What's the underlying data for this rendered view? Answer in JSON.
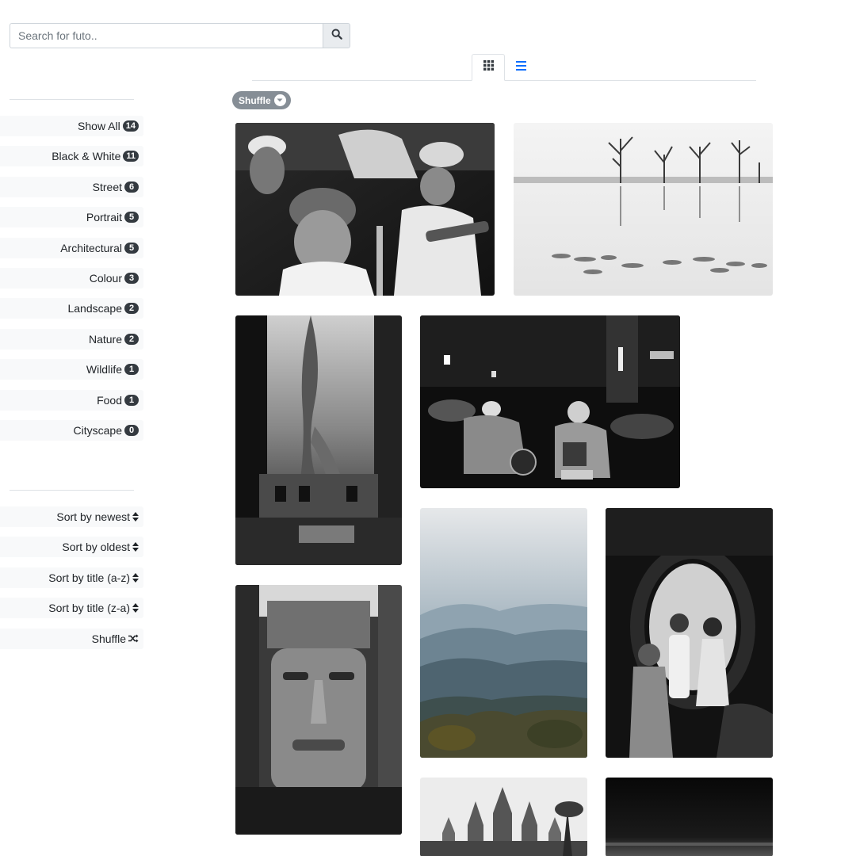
{
  "search": {
    "placeholder": "Search for futo..",
    "value": "",
    "icon": "search-icon"
  },
  "view_tabs": [
    {
      "name": "grid",
      "icon": "grid-icon",
      "active": true
    },
    {
      "name": "list",
      "icon": "list-icon",
      "active": false,
      "color": "#0d6efd"
    }
  ],
  "shuffle_pill": {
    "label": "Shuffle",
    "icon": "chevron-down-icon"
  },
  "filters": [
    {
      "label": "Show All",
      "count": "14"
    },
    {
      "label": "Black & White",
      "count": "11"
    },
    {
      "label": "Street",
      "count": "6"
    },
    {
      "label": "Portrait",
      "count": "5"
    },
    {
      "label": "Architectural",
      "count": "5"
    },
    {
      "label": "Colour",
      "count": "3"
    },
    {
      "label": "Landscape",
      "count": "2"
    },
    {
      "label": "Nature",
      "count": "2"
    },
    {
      "label": "Wildlife",
      "count": "1"
    },
    {
      "label": "Food",
      "count": "1"
    },
    {
      "label": "Cityscape",
      "count": "0"
    }
  ],
  "sorts": [
    {
      "label": "Sort by newest",
      "icon": "sort-icon"
    },
    {
      "label": "Sort by oldest",
      "icon": "sort-icon"
    },
    {
      "label": "Sort by title (a-z)",
      "icon": "sort-icon"
    },
    {
      "label": "Sort by title (z-a)",
      "icon": "sort-icon"
    },
    {
      "label": "Shuffle",
      "icon": "shuffle-icon"
    }
  ],
  "photos": [
    {
      "subject": "street-musicians",
      "tone": "bw"
    },
    {
      "subject": "lake-trees",
      "tone": "bw"
    },
    {
      "subject": "temple-tree",
      "tone": "bw"
    },
    {
      "subject": "motorbike-street",
      "tone": "bw"
    },
    {
      "subject": "stone-face",
      "tone": "bw"
    },
    {
      "subject": "mountain-mist",
      "tone": "colour"
    },
    {
      "subject": "couple-portrait",
      "tone": "bw"
    },
    {
      "subject": "angkor-wat",
      "tone": "bw"
    },
    {
      "subject": "dark-water",
      "tone": "bw"
    }
  ],
  "colors": {
    "badge": "#343a40",
    "pill": "#868e96",
    "accent": "#0d6efd",
    "item_bg": "#f8f9fa"
  }
}
